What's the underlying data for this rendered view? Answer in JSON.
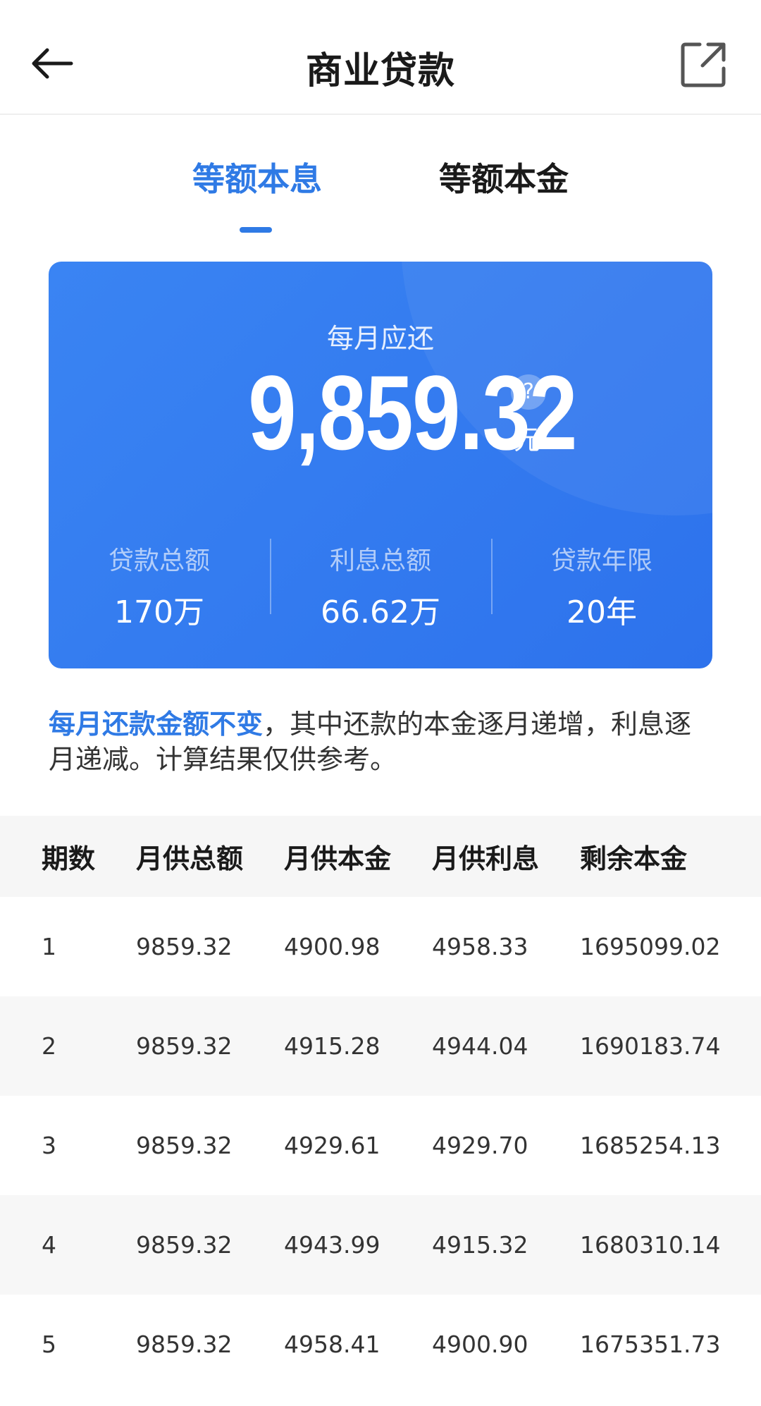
{
  "header": {
    "title": "商业贷款"
  },
  "tabs": [
    {
      "label": "等额本息"
    },
    {
      "label": "等额本金"
    }
  ],
  "summary": {
    "label": "每月应还",
    "amount": "9,859.32",
    "help": "?",
    "unit": "元",
    "stats": [
      {
        "label": "贷款总额",
        "value": "170万"
      },
      {
        "label": "利息总额",
        "value": "66.62万"
      },
      {
        "label": "贷款年限",
        "value": "20年"
      }
    ]
  },
  "note": {
    "highlight": "每月还款金额不变",
    "text": "，其中还款的本金逐月递增，利息逐月递减。计算结果仅供参考。"
  },
  "table": {
    "headers": [
      "期数",
      "月供总额",
      "月供本金",
      "月供利息",
      "剩余本金"
    ],
    "rows": [
      [
        "1",
        "9859.32",
        "4900.98",
        "4958.33",
        "1695099.02"
      ],
      [
        "2",
        "9859.32",
        "4915.28",
        "4944.04",
        "1690183.74"
      ],
      [
        "3",
        "9859.32",
        "4929.61",
        "4929.70",
        "1685254.13"
      ],
      [
        "4",
        "9859.32",
        "4943.99",
        "4915.32",
        "1680310.14"
      ],
      [
        "5",
        "9859.32",
        "4958.41",
        "4900.90",
        "1675351.73"
      ]
    ]
  },
  "colors": {
    "accent": "#2f7ae5",
    "card": "#3a84f3"
  }
}
